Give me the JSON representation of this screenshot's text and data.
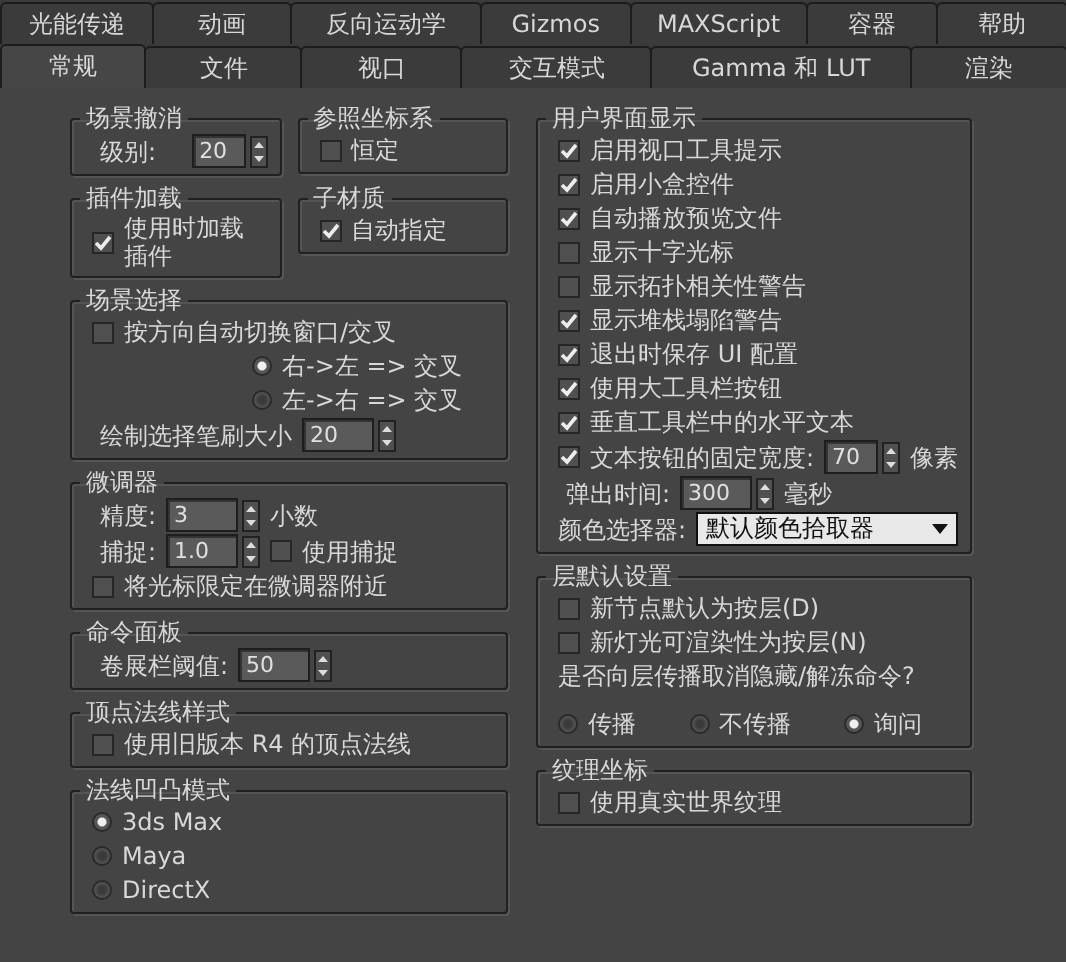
{
  "tabs_row1": [
    {
      "label": "光能传递",
      "selected": false
    },
    {
      "label": "动画",
      "selected": false
    },
    {
      "label": "反向运动学",
      "selected": false
    },
    {
      "label": "Gizmos",
      "selected": false
    },
    {
      "label": "MAXScript",
      "selected": false
    },
    {
      "label": "容器",
      "selected": false
    },
    {
      "label": "帮助",
      "selected": false
    }
  ],
  "tabs_row2": [
    {
      "label": "常规",
      "selected": true
    },
    {
      "label": "文件",
      "selected": false
    },
    {
      "label": "视口",
      "selected": false
    },
    {
      "label": "交互模式",
      "selected": false
    },
    {
      "label": "Gamma 和 LUT",
      "selected": false
    },
    {
      "label": "渲染",
      "selected": false
    }
  ],
  "left_column": [
    [
      {
        "title": "场景撤消",
        "items": [
          {
            "kind": "spinner",
            "label": "级别:",
            "value": "20"
          }
        ]
      },
      {
        "title": "参照坐标系",
        "items": [
          {
            "kind": "checkbox",
            "label": "恒定",
            "checked": false
          }
        ]
      }
    ],
    [
      {
        "title": "插件加载",
        "items": [
          {
            "kind": "checkbox",
            "label": "使用时加载插件",
            "checked": true
          }
        ]
      },
      {
        "title": "子材质",
        "items": [
          {
            "kind": "checkbox",
            "label": "自动指定",
            "checked": true
          }
        ]
      }
    ],
    [
      {
        "title": "场景选择",
        "items": [
          {
            "kind": "checkbox",
            "label": "按方向自动切换窗口/交叉",
            "checked": false,
            "children": [
              {
                "kind": "radio",
                "label": "右->左 => 交叉",
                "selected": true
              },
              {
                "kind": "radio",
                "label": "左->右 => 交叉",
                "selected": false
              }
            ]
          },
          {
            "kind": "spinner",
            "label": "绘制选择笔刷大小",
            "value": "20"
          }
        ]
      }
    ],
    [
      {
        "title": "微调器",
        "items": [
          {
            "kind": "spinner",
            "label": "精度:",
            "value": "3",
            "unit": "小数"
          },
          {
            "kind": "spinner-checkbox",
            "label": "捕捉:",
            "value": "1.0",
            "check_label": "使用捕捉",
            "checked": false
          },
          {
            "kind": "checkbox",
            "label": "将光标限定在微调器附近",
            "checked": false
          }
        ]
      }
    ],
    [
      {
        "title": "命令面板",
        "items": [
          {
            "kind": "spinner",
            "label": "卷展栏阈值:",
            "value": "50"
          }
        ]
      }
    ],
    [
      {
        "title": "顶点法线样式",
        "items": [
          {
            "kind": "checkbox",
            "label": "使用旧版本 R4 的顶点法线",
            "checked": false
          }
        ]
      }
    ],
    [
      {
        "title": "法线凹凸模式",
        "items": [
          {
            "kind": "radio",
            "label": "3ds Max",
            "selected": true
          },
          {
            "kind": "radio",
            "label": "Maya",
            "selected": false
          },
          {
            "kind": "radio",
            "label": "DirectX",
            "selected": false
          }
        ]
      }
    ]
  ],
  "right_column": [
    {
      "title": "用户界面显示",
      "items": [
        {
          "kind": "checkbox",
          "label": "启用视口工具提示",
          "checked": true
        },
        {
          "kind": "checkbox",
          "label": "启用小盒控件",
          "checked": true
        },
        {
          "kind": "checkbox",
          "label": "自动播放预览文件",
          "checked": true
        },
        {
          "kind": "checkbox",
          "label": "显示十字光标",
          "checked": false
        },
        {
          "kind": "checkbox",
          "label": "显示拓扑相关性警告",
          "checked": false
        },
        {
          "kind": "checkbox",
          "label": "显示堆栈塌陷警告",
          "checked": true
        },
        {
          "kind": "checkbox",
          "label": "退出时保存 UI 配置",
          "checked": true
        },
        {
          "kind": "checkbox",
          "label": "使用大工具栏按钮",
          "checked": true
        },
        {
          "kind": "checkbox",
          "label": "垂直工具栏中的水平文本",
          "checked": true
        },
        {
          "kind": "checkbox-spinner",
          "label": "文本按钮的固定宽度:",
          "checked": true,
          "value": "70",
          "unit": "像素"
        },
        {
          "kind": "spinner",
          "label": "弹出时间:",
          "value": "300",
          "unit": "毫秒"
        },
        {
          "kind": "dropdown",
          "label": "颜色选择器:",
          "value": "默认颜色拾取器"
        }
      ]
    },
    {
      "title": "层默认设置",
      "items": [
        {
          "kind": "checkbox",
          "label": "新节点默认为按层(D)",
          "checked": false
        },
        {
          "kind": "checkbox",
          "label": "新灯光可渲染性为按层(N)",
          "checked": false
        },
        {
          "kind": "text",
          "label": "是否向层传播取消隐藏/解冻命令?"
        },
        {
          "kind": "radio-row",
          "options": [
            {
              "label": "传播",
              "selected": false
            },
            {
              "label": "不传播",
              "selected": false
            },
            {
              "label": "询问",
              "selected": true
            }
          ]
        }
      ]
    },
    {
      "title": "纹理坐标",
      "items": [
        {
          "kind": "checkbox",
          "label": "使用真实世界纹理",
          "checked": false
        }
      ]
    }
  ]
}
